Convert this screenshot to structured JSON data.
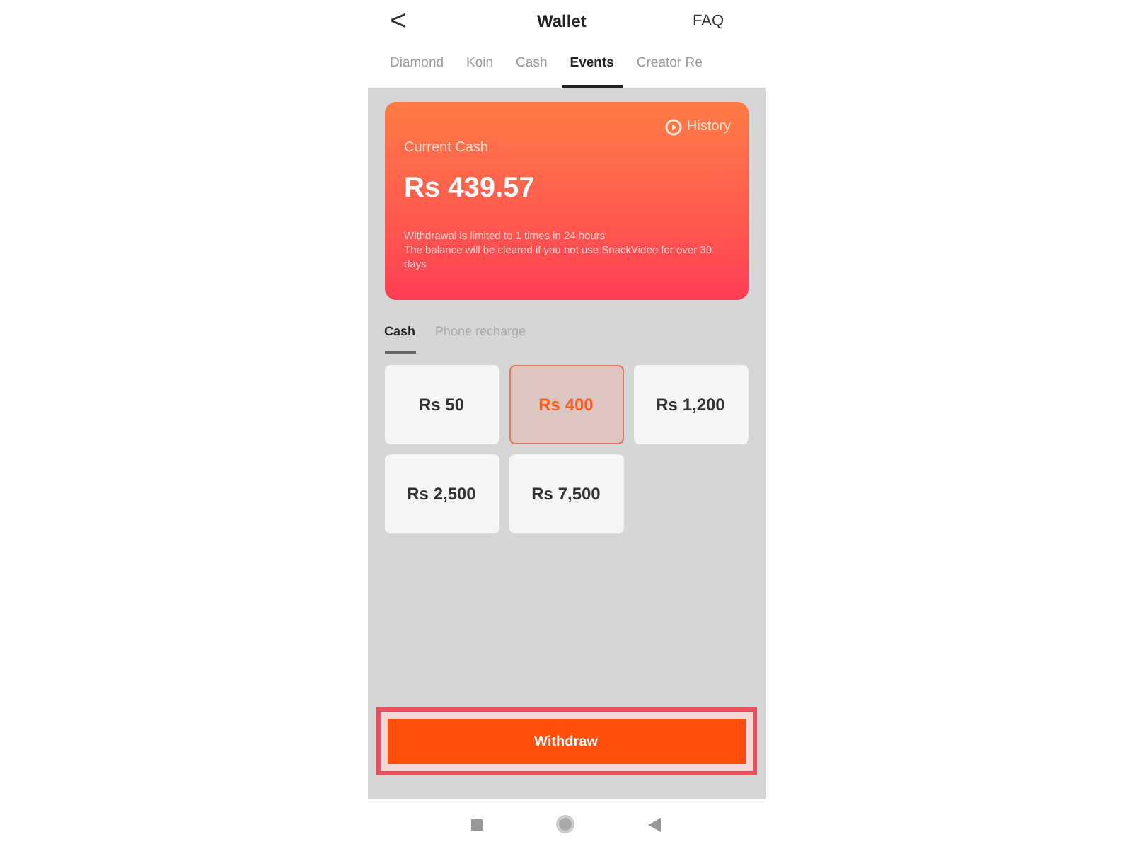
{
  "header": {
    "back": "<",
    "title": "Wallet",
    "faq": "FAQ"
  },
  "tabs": [
    {
      "label": "Diamond",
      "selected": false
    },
    {
      "label": "Koin",
      "selected": false
    },
    {
      "label": "Cash",
      "selected": false
    },
    {
      "label": "Events",
      "selected": true
    },
    {
      "label": "Creator Re",
      "selected": false
    }
  ],
  "card": {
    "history": "History",
    "label": "Current Cash",
    "amount": "Rs 439.57",
    "notes": [
      "Withdrawal is limited to 1 times in 24 hours",
      "The balance will be cleared if you not use SnackVideo for over 30 days"
    ]
  },
  "subtabs": [
    {
      "label": "Cash",
      "selected": true
    },
    {
      "label": "Phone recharge",
      "selected": false
    }
  ],
  "amounts": [
    {
      "label": "Rs 50",
      "selected": false
    },
    {
      "label": "Rs 400",
      "selected": true
    },
    {
      "label": "Rs 1,200",
      "selected": false
    },
    {
      "label": "Rs 2,500",
      "selected": false
    },
    {
      "label": "Rs 7,500",
      "selected": false
    }
  ],
  "withdraw": {
    "label": "Withdraw",
    "highlighted": true
  }
}
